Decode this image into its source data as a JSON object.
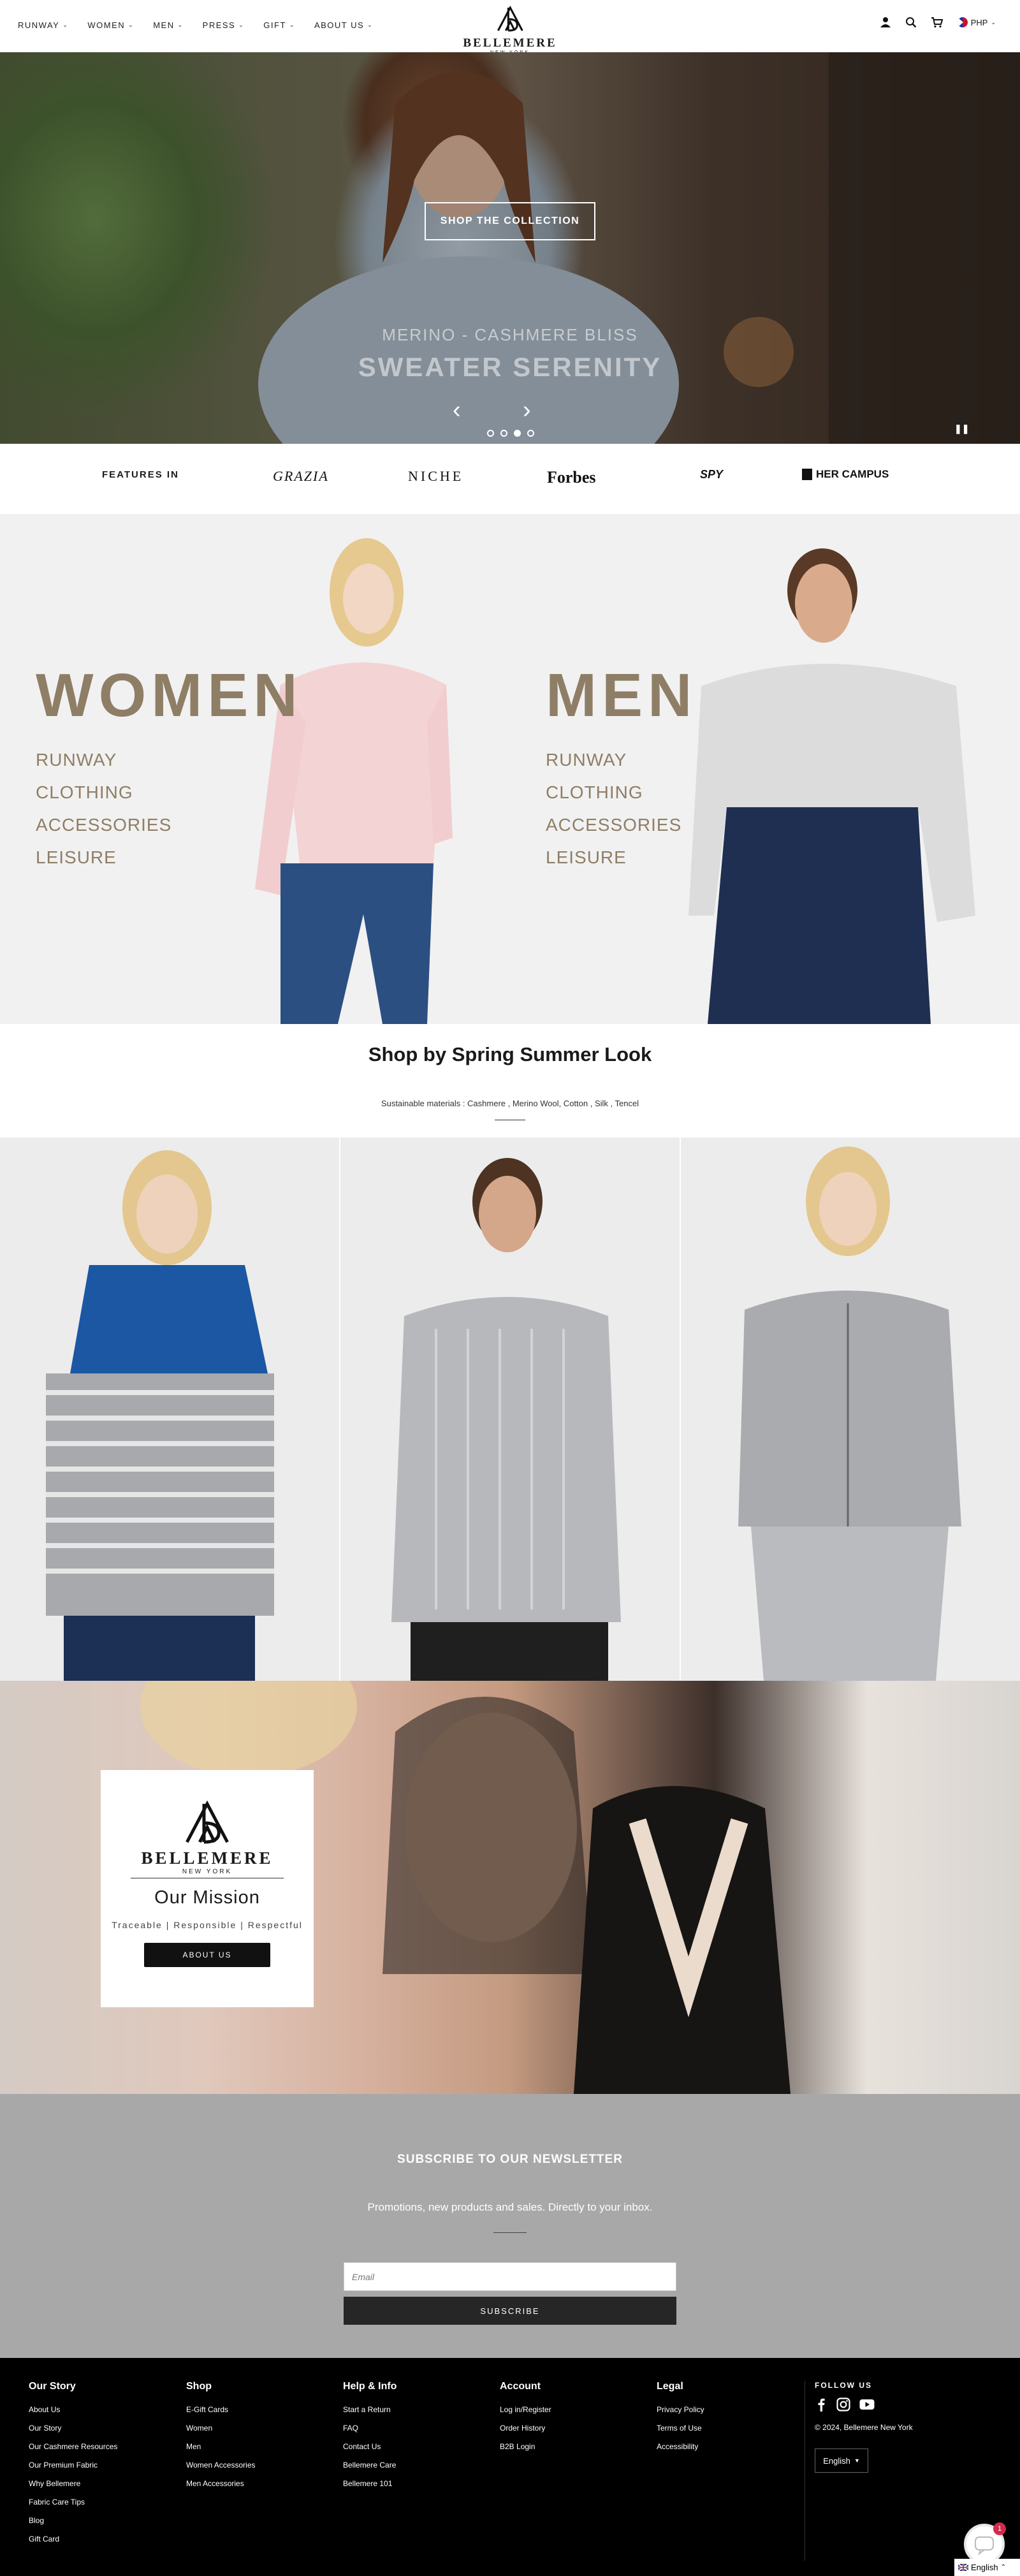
{
  "header": {
    "nav": [
      {
        "label": "RUNWAY"
      },
      {
        "label": "WOMEN"
      },
      {
        "label": "MEN"
      },
      {
        "label": "PRESS"
      },
      {
        "label": "GIFT"
      },
      {
        "label": "ABOUT US"
      }
    ],
    "logo_name": "BELLEMERE",
    "logo_sub": "NEW YORK",
    "currency": "PHP"
  },
  "hero": {
    "button": "SHOP THE COLLECTION",
    "subtitle": "MERINO - CASHMERE BLISS",
    "title": "SWEATER SERENITY",
    "slides": 4,
    "active_slide": 3
  },
  "features": {
    "label": "FEATURES IN",
    "press": [
      "GRAZIA",
      "NICHE",
      "Forbes",
      "SPY",
      "HER CAMPUS"
    ]
  },
  "women": {
    "title": "WOMEN",
    "links": [
      "RUNWAY",
      "CLOTHING",
      "ACCESSORIES",
      "LEISURE"
    ]
  },
  "men": {
    "title": "MEN",
    "links": [
      "RUNWAY",
      "CLOTHING",
      "ACCESSORIES",
      "LEISURE"
    ]
  },
  "spring": {
    "title": "Shop by Spring Summer Look",
    "subtitle": "Sustainable materials : Cashmere , Merino Wool, Cotton , Silk , Tencel"
  },
  "mission": {
    "logo_name": "BELLEMERE",
    "logo_sub": "NEW YORK",
    "title": "Our Mission",
    "tags": "Traceable | Responsible | Respectful",
    "button": "ABOUT US"
  },
  "newsletter": {
    "title": "SUBSCRIBE TO OUR NEWSLETTER",
    "subtitle": "Promotions, new products and sales. Directly to your inbox.",
    "placeholder": "Email",
    "button": "SUBSCRIBE"
  },
  "footer": {
    "columns": [
      {
        "heading": "Our Story",
        "links": [
          "About Us",
          "Our Story",
          "Our Cashmere Resources",
          "Our Premium Fabric",
          "Why Bellemere",
          "Fabric Care Tips",
          "Blog",
          "Gift Card"
        ]
      },
      {
        "heading": "Shop",
        "links": [
          "E-Gift Cards",
          "Women",
          "Men",
          "Women Accessories",
          "Men Accessories"
        ]
      },
      {
        "heading": "Help & Info",
        "links": [
          "Start a Return",
          "FAQ",
          "Contact Us",
          "Bellemere Care",
          "Bellemere 101"
        ]
      },
      {
        "heading": "Account",
        "links": [
          "Log in/Register",
          "Order History",
          "B2B Login"
        ]
      },
      {
        "heading": "Legal",
        "links": [
          "Privacy Policy",
          "Terms of Use",
          "Accessibility"
        ]
      }
    ],
    "follow_us": "FOLLOW US",
    "copyright": "© 2024, Bellemere New York",
    "language": "English",
    "chat_badge": "1",
    "lang_bar": "English"
  }
}
